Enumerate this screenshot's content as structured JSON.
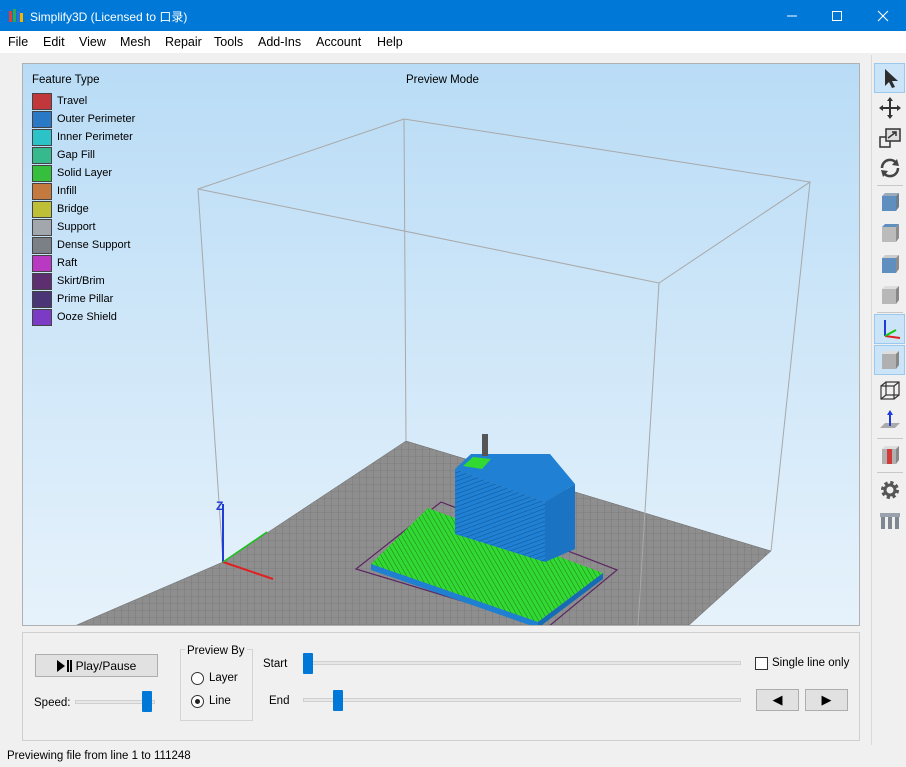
{
  "window": {
    "title": "Simplify3D (Licensed to 口录)",
    "minimize_glyph": "—",
    "maximize_glyph": "☐",
    "close_glyph": "✕"
  },
  "menu": [
    "File",
    "Edit",
    "View",
    "Mesh",
    "Repair",
    "Tools",
    "Add-Ins",
    "Account",
    "Help"
  ],
  "viewport": {
    "legend_title": "Feature Type",
    "mode_label": "Preview Mode",
    "axis_label": "Z",
    "legend": [
      {
        "label": "Travel",
        "color": "#c1373b"
      },
      {
        "label": "Outer Perimeter",
        "color": "#2a79c6"
      },
      {
        "label": "Inner Perimeter",
        "color": "#2cc3c8"
      },
      {
        "label": "Gap Fill",
        "color": "#36b98d"
      },
      {
        "label": "Solid Layer",
        "color": "#35bf3c"
      },
      {
        "label": "Infill",
        "color": "#c47a3e"
      },
      {
        "label": "Bridge",
        "color": "#bfbe37"
      },
      {
        "label": "Support",
        "color": "#a2a6ad"
      },
      {
        "label": "Dense Support",
        "color": "#7b7f86"
      },
      {
        "label": "Raft",
        "color": "#b939c3"
      },
      {
        "label": "Skirt/Brim",
        "color": "#5d2f71"
      },
      {
        "label": "Prime Pillar",
        "color": "#4a3577"
      },
      {
        "label": "Ooze Shield",
        "color": "#7b3bc4"
      }
    ]
  },
  "controls": {
    "play_pause_label": "Play/Pause",
    "speed_label": "Speed:",
    "speed_value": 0.95,
    "preview_by_title": "Preview By",
    "layer_label": "Layer",
    "line_label": "Line",
    "selected_mode": "Line",
    "start_label": "Start",
    "end_label": "End",
    "start_value": 0,
    "end_value": 0.07,
    "single_line_label": "Single line only",
    "single_line_checked": false,
    "prev_glyph": "◀",
    "next_glyph": "▶"
  },
  "status": {
    "text": "Previewing file from line 1 to 111248"
  },
  "toolbar": [
    {
      "name": "select-tool-icon",
      "active": true
    },
    {
      "name": "move-tool-icon",
      "active": false
    },
    {
      "name": "scale-tool-icon",
      "active": false
    },
    {
      "name": "rotate-tool-icon",
      "active": false
    },
    {
      "name": "view-front-icon",
      "active": false
    },
    {
      "name": "view-top-icon",
      "active": false
    },
    {
      "name": "view-left-icon",
      "active": false
    },
    {
      "name": "view-right-icon",
      "active": false
    },
    {
      "name": "axes-toggle-icon",
      "active": true
    },
    {
      "name": "solid-model-icon",
      "active": true
    },
    {
      "name": "wireframe-icon",
      "active": false
    },
    {
      "name": "normals-icon",
      "active": false
    },
    {
      "name": "cross-section-icon",
      "active": false
    },
    {
      "name": "settings-gear-icon",
      "active": false
    },
    {
      "name": "supports-icon",
      "active": false
    }
  ],
  "colors": {
    "accent": "#0078d7",
    "model_blue": "#1f7fd0",
    "infill_green": "#2fd12f"
  }
}
